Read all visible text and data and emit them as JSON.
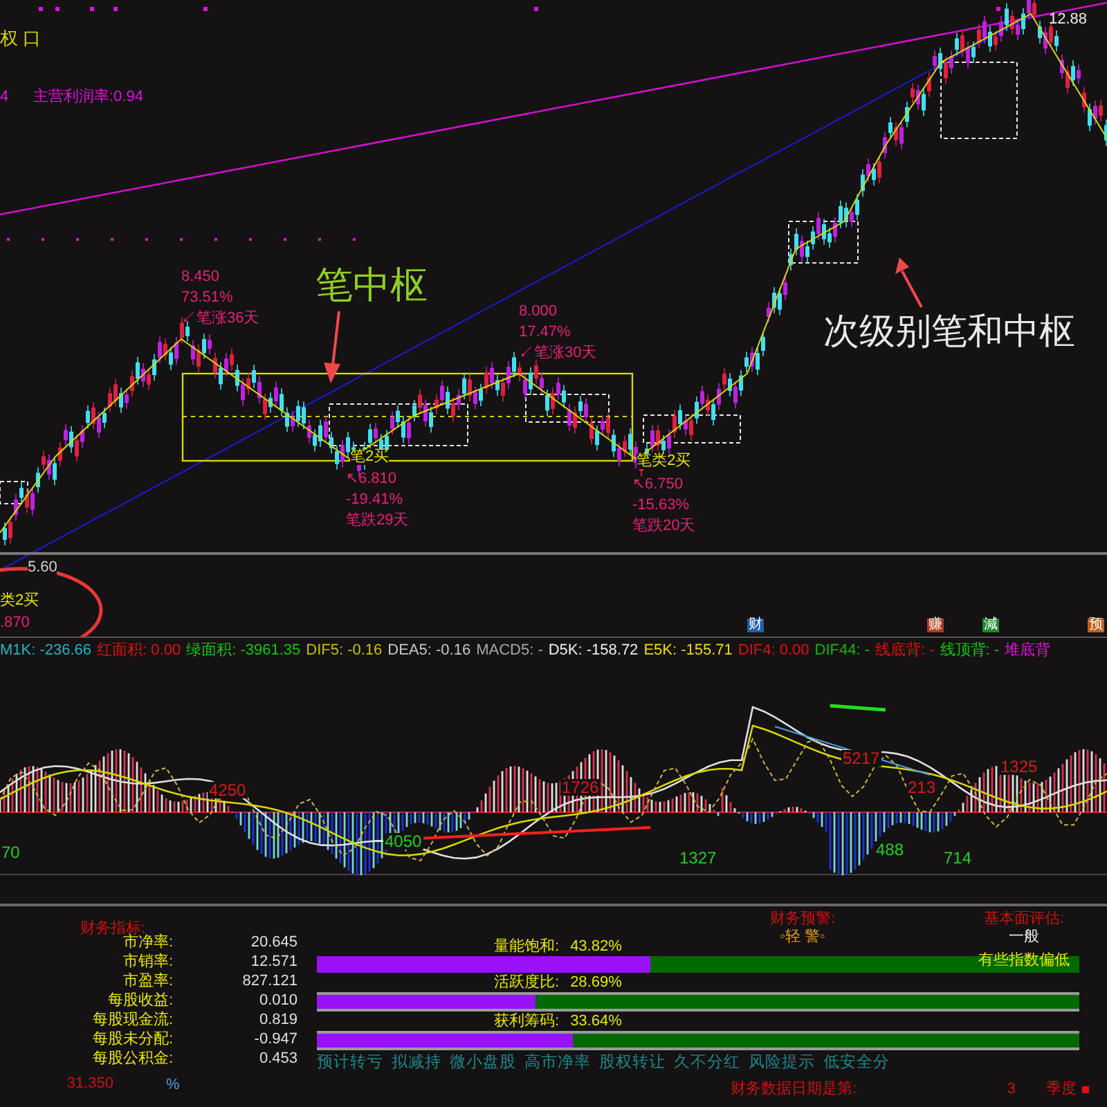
{
  "header": {
    "title": "权 口",
    "left_value": "4",
    "ratio": "主营利润率:0.94",
    "high": "12.88"
  },
  "price_chart": {
    "callouts": [
      {
        "kind": "zone",
        "text": "笔中枢"
      },
      {
        "kind": "sub",
        "text": "次级别笔和中枢"
      }
    ],
    "points": [
      {
        "kind": "peak",
        "lines": [
          "8.450",
          "73.51%",
          "↙笔涨36天"
        ]
      },
      {
        "kind": "trough",
        "signal": "笔2买",
        "lines": [
          "↖6.810",
          "-19.41%",
          "笔跌29天"
        ]
      },
      {
        "kind": "peak",
        "lines": [
          "8.000",
          "17.47%",
          "↙笔涨30天"
        ]
      },
      {
        "kind": "trough",
        "signal": "笔类2买",
        "lines": [
          "↖6.750",
          "-15.63%",
          "笔跌20天"
        ]
      }
    ],
    "edge_note": {
      "value": "5.60",
      "signal": "类2买",
      "price": ".870"
    },
    "markers": [
      {
        "text": "财",
        "color": "#1f5fa8"
      },
      {
        "text": "赚",
        "color": "#b03a1a"
      },
      {
        "text": "減",
        "color": "#1f8a2a"
      },
      {
        "text": "预",
        "color": "#c0601a"
      }
    ]
  },
  "indicator": {
    "readings": [
      {
        "text": "M1K: -236.66",
        "color": "#20b8c0"
      },
      {
        "text": "红面积: 0.00",
        "color": "#e01010"
      },
      {
        "text": "绿面积: -3961.35",
        "color": "#10c810"
      },
      {
        "text": "DIF5: -0.16",
        "color": "#c8c000"
      },
      {
        "text": "DEA5: -0.16",
        "color": "#c8c8c8"
      },
      {
        "text": "MACD5: -",
        "color": "#a8a8a8"
      },
      {
        "text": "D5K: -158.72",
        "color": "#f0f0f0"
      },
      {
        "text": "E5K: -155.71",
        "color": "#e8e000"
      },
      {
        "text": "DIF4: 0.00",
        "color": "#e01010"
      },
      {
        "text": "DIF44: -",
        "color": "#10b810"
      },
      {
        "text": "线底背: -",
        "color": "#e01010"
      },
      {
        "text": "线顶背: -",
        "color": "#10c810"
      },
      {
        "text": "堆底背",
        "color": "#e010e0"
      }
    ],
    "labels": [
      {
        "kind": "up",
        "text": "4250"
      },
      {
        "kind": "up",
        "text": "1726"
      },
      {
        "kind": "up",
        "text": "5217"
      },
      {
        "kind": "up",
        "text": "213"
      },
      {
        "kind": "up",
        "text": "1325"
      },
      {
        "kind": "down",
        "text": "70"
      },
      {
        "kind": "down",
        "text": "4050"
      },
      {
        "kind": "down",
        "text": "1327"
      },
      {
        "kind": "down",
        "text": "488"
      },
      {
        "kind": "down",
        "text": "714"
      }
    ]
  },
  "finance": {
    "title": "财务指标:",
    "rows": [
      {
        "label": "市净率:",
        "value": "20.645"
      },
      {
        "label": "市销率:",
        "value": "12.571"
      },
      {
        "label": "市盈率:",
        "value": "827.121"
      },
      {
        "label": "每股收益:",
        "value": "0.010"
      },
      {
        "label": "每股现金流:",
        "value": "0.819"
      },
      {
        "label": "每股未分配:",
        "value": "-0.947"
      },
      {
        "label": "每股公积金:",
        "value": "0.453"
      }
    ],
    "footer_value": "31.350",
    "footer_unit": "%",
    "meters": [
      {
        "label": "量能饱和:",
        "reading": "43.82%",
        "level": 0.4382
      },
      {
        "label": "活跃度比:",
        "reading": "28.69%",
        "level": 0.2869
      },
      {
        "label": "获利筹码:",
        "reading": "33.64%",
        "level": 0.3364
      }
    ],
    "tags": [
      "预计转亏",
      "拟减持",
      "微小盘股",
      "高市净率",
      "股权转让",
      "久不分红",
      "风险提示",
      "低安全分"
    ],
    "warning": {
      "title": "财务预警:",
      "value": "◦轻 警◦"
    },
    "assessment": {
      "title": "基本面评估:",
      "value": "一般",
      "note": "有些指数偏低"
    },
    "date": {
      "label": "财务数据日期是第:",
      "value": "3",
      "unit": "季度"
    }
  }
}
